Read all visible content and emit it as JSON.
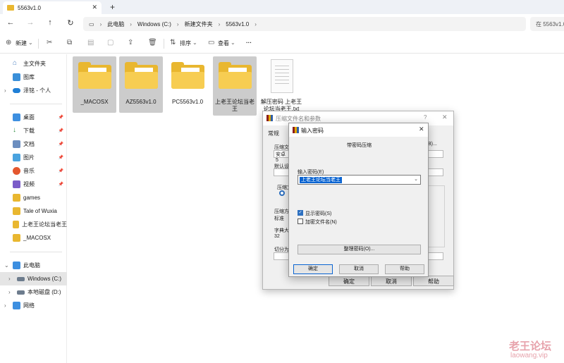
{
  "window": {
    "tab_title": "5563v1.0",
    "new_tab": "+",
    "tab_close": "✕"
  },
  "address": {
    "breadcrumb": [
      "此电脑",
      "Windows (C:)",
      "新建文件夹",
      "5563v1.0"
    ],
    "search_placeholder": "在 5563v1.0"
  },
  "command_bar": {
    "new_label": "新建",
    "sort_label": "排序",
    "view_label": "查看",
    "more_label": "···"
  },
  "sidebar": {
    "quick": [
      {
        "label": "主文件夹",
        "icon": "home-icon"
      },
      {
        "label": "图库",
        "icon": "gallery-icon"
      },
      {
        "label": "泽铭 - 个人",
        "icon": "cloud-icon"
      }
    ],
    "pinned": [
      {
        "label": "桌面",
        "icon": "desktop-icon"
      },
      {
        "label": "下载",
        "icon": "download-icon"
      },
      {
        "label": "文档",
        "icon": "documents-icon"
      },
      {
        "label": "图片",
        "icon": "pictures-icon"
      },
      {
        "label": "音乐",
        "icon": "music-icon"
      },
      {
        "label": "视频",
        "icon": "videos-icon"
      },
      {
        "label": "games",
        "icon": "folder-icon"
      },
      {
        "label": "Tale of Wuxia",
        "icon": "folder-icon"
      },
      {
        "label": "上老王论坛当老王",
        "icon": "folder-icon"
      },
      {
        "label": "_MACOSX",
        "icon": "folder-icon"
      }
    ],
    "drives": [
      {
        "label": "此电脑",
        "icon": "pc-icon"
      },
      {
        "label": "Windows (C:)",
        "icon": "drive-icon"
      },
      {
        "label": "本地磁盘 (D:)",
        "icon": "drive-icon"
      },
      {
        "label": "网络",
        "icon": "network-icon"
      }
    ]
  },
  "files": [
    {
      "name": "_MACOSX",
      "type": "folder",
      "selected": true
    },
    {
      "name": "AZ5563v1.0",
      "type": "folder",
      "selected": true
    },
    {
      "name": "PC5563v1.0",
      "type": "folder",
      "selected": false
    },
    {
      "name": "上老王论坛当老王",
      "type": "folder",
      "selected": true
    },
    {
      "name": "解压密码 上老王论坛当老王.txt",
      "type": "text",
      "selected": false
    }
  ],
  "archive_dialog": {
    "title": "压缩文件名和参数",
    "help_glyph": "?",
    "tab_general": "常规",
    "labels": [
      "压缩文",
      "默认设置",
      "压缩文",
      "压缩方",
      "标准",
      "字典大",
      "32",
      "切分为"
    ],
    "field_value": "安卓 5"
  },
  "password_dialog": {
    "title": "输入密码",
    "heading": "带密码压缩",
    "password_label": "输入密码(E)",
    "password_value": "上老王论坛当老王",
    "show_password": "显示密码(S)",
    "encrypt_names": "加密文件名(N)",
    "organize_button": "整理密码(O)...",
    "ok_button": "确定",
    "cancel_button": "取消",
    "help_button": "帮助"
  },
  "back_dialog_buttons": {
    "ok": "确定",
    "cancel": "取消",
    "help": "帮助"
  },
  "watermark": {
    "line1": "老王论坛",
    "line2": "laowang.vip"
  }
}
